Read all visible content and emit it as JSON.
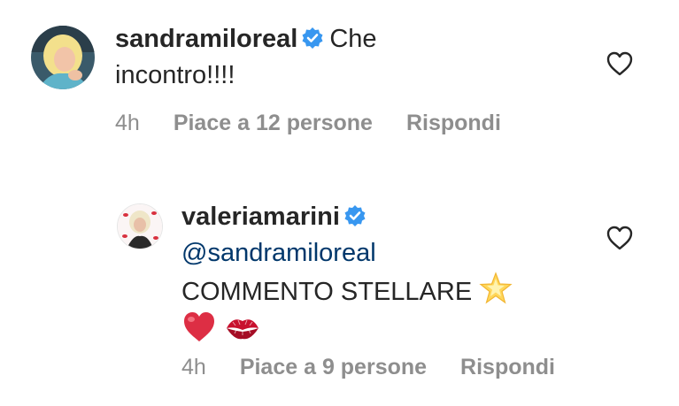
{
  "comments": [
    {
      "username": "sandramiloreal",
      "verified": true,
      "text": "Che incontro!!!!",
      "text_line1": "Che",
      "text_line2": "incontro!!!!",
      "time": "4h",
      "likes": "Piace a 12 persone",
      "reply": "Rispondi",
      "avatar_icon": "avatar-photo",
      "like_icon": "heart-outline-icon"
    },
    {
      "username": "valeriamarini",
      "verified": true,
      "mention": "@sandramiloreal",
      "text": "COMMENTO STELLARE",
      "emoji_1": "glowing-star",
      "emoji_2": "red-heart",
      "emoji_3": "kiss-mark",
      "time": "4h",
      "likes": "Piace a 9 persone",
      "reply": "Rispondi",
      "avatar_icon": "avatar-photo",
      "like_icon": "heart-outline-icon"
    }
  ],
  "colors": {
    "text": "#262626",
    "meta": "#8e8e8e",
    "mention": "#00376b",
    "verified": "#3897f0"
  }
}
